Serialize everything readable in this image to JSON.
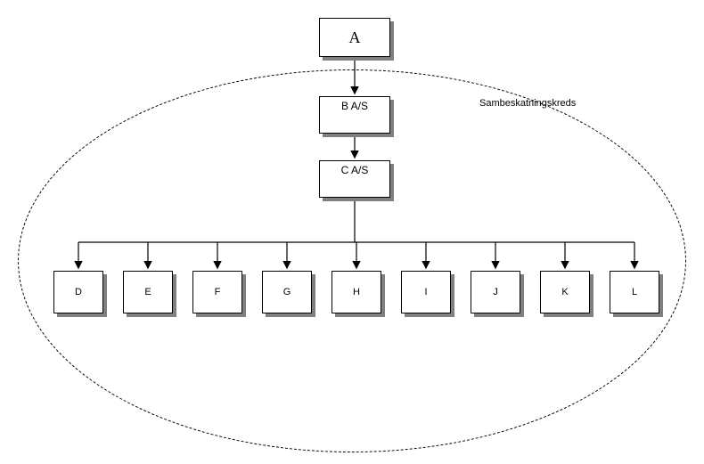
{
  "diagram": {
    "ellipse_label": "Sambeskatningskreds",
    "nodes": {
      "a": "A",
      "b": "B A/S",
      "c": "C A/S",
      "d": "D",
      "e": "E",
      "f": "F",
      "g": "G",
      "h": "H",
      "i": "I",
      "j": "J",
      "k": "K",
      "l": "L"
    }
  },
  "chart_data": {
    "type": "diagram",
    "title": "",
    "group_label": "Sambeskatningskreds",
    "nodes": [
      {
        "id": "A",
        "label": "A",
        "in_group": false
      },
      {
        "id": "B",
        "label": "B A/S",
        "in_group": true
      },
      {
        "id": "C",
        "label": "C A/S",
        "in_group": true
      },
      {
        "id": "D",
        "label": "D",
        "in_group": true
      },
      {
        "id": "E",
        "label": "E",
        "in_group": true
      },
      {
        "id": "F",
        "label": "F",
        "in_group": true
      },
      {
        "id": "G",
        "label": "G",
        "in_group": true
      },
      {
        "id": "H",
        "label": "H",
        "in_group": true
      },
      {
        "id": "I",
        "label": "I",
        "in_group": true
      },
      {
        "id": "J",
        "label": "J",
        "in_group": true
      },
      {
        "id": "K",
        "label": "K",
        "in_group": true
      },
      {
        "id": "L",
        "label": "L",
        "in_group": true
      }
    ],
    "edges": [
      {
        "from": "A",
        "to": "B"
      },
      {
        "from": "B",
        "to": "C"
      },
      {
        "from": "C",
        "to": "D"
      },
      {
        "from": "C",
        "to": "E"
      },
      {
        "from": "C",
        "to": "F"
      },
      {
        "from": "C",
        "to": "G"
      },
      {
        "from": "C",
        "to": "H"
      },
      {
        "from": "C",
        "to": "I"
      },
      {
        "from": "C",
        "to": "J"
      },
      {
        "from": "C",
        "to": "K"
      },
      {
        "from": "C",
        "to": "L"
      }
    ]
  }
}
